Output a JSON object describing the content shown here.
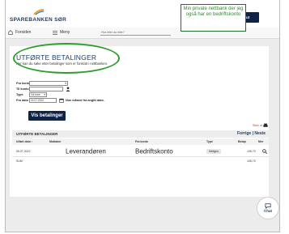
{
  "header": {
    "logo_text": "SPAREBANKEN SØR",
    "logout_label": "Logg ut",
    "callout": "Min private nettbank der jeg også har en bedriftskonto"
  },
  "nav": {
    "home_label": "Forsiden",
    "menu_label": "Meny",
    "search_placeholder": "Hva leter du etter?"
  },
  "page": {
    "title": "UTFØRTE BETALINGER",
    "subtitle": "Her kan du søke etter betalinger som er foretatt i nettbanken."
  },
  "form": {
    "from_account_label": "Fra konto:",
    "from_account_value": "",
    "to_account_label": "Til konto",
    "to_account_value": "",
    "type_label": "Type",
    "type_value": "Vis bare",
    "from_date_label": "Fra dato",
    "from_date_value": "04.07.2022",
    "date_hint": "Noe måned fra angitt dato.",
    "submit_label": "Vis betalinger"
  },
  "print_label": "Skriv ut",
  "table": {
    "title": "UTFØRTE BETALINGER",
    "pager": "Forrige | Neste",
    "columns": [
      "Utført dato",
      "Mottaker",
      "Fra konto",
      "Type",
      "Beløp",
      "Mer"
    ],
    "rows": [
      {
        "date": "05.07.2022",
        "recipient": "Leverandøren",
        "from_account": "Bedriftskonto",
        "type": "Nettgiro",
        "amount": "105,70"
      }
    ],
    "sum_label": "SUM",
    "sum_value": "105,70"
  },
  "chat_label": "Chat",
  "colors": {
    "brand_navy": "#0f2347",
    "highlight_green": "#2f9e2f",
    "link_red": "#c0392b"
  }
}
